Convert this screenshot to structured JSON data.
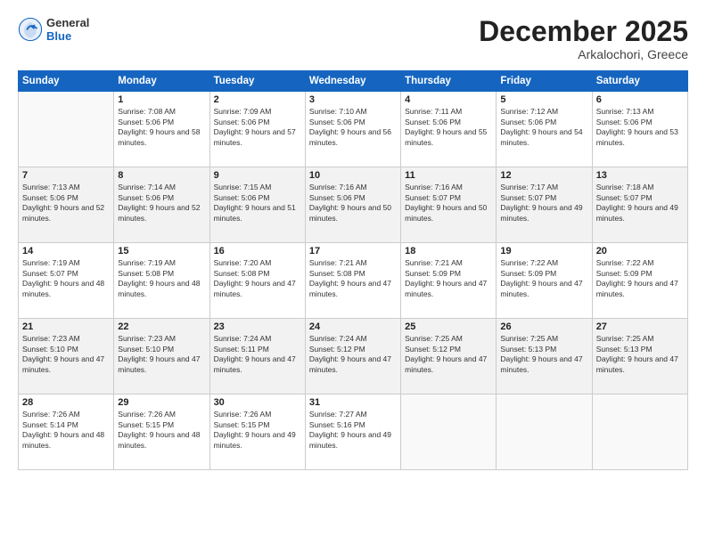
{
  "header": {
    "logo_general": "General",
    "logo_blue": "Blue",
    "month_title": "December 2025",
    "location": "Arkalochori, Greece"
  },
  "days_of_week": [
    "Sunday",
    "Monday",
    "Tuesday",
    "Wednesday",
    "Thursday",
    "Friday",
    "Saturday"
  ],
  "weeks": [
    [
      {
        "day": "",
        "sunrise": "",
        "sunset": "",
        "daylight": ""
      },
      {
        "day": "1",
        "sunrise": "Sunrise: 7:08 AM",
        "sunset": "Sunset: 5:06 PM",
        "daylight": "Daylight: 9 hours and 58 minutes."
      },
      {
        "day": "2",
        "sunrise": "Sunrise: 7:09 AM",
        "sunset": "Sunset: 5:06 PM",
        "daylight": "Daylight: 9 hours and 57 minutes."
      },
      {
        "day": "3",
        "sunrise": "Sunrise: 7:10 AM",
        "sunset": "Sunset: 5:06 PM",
        "daylight": "Daylight: 9 hours and 56 minutes."
      },
      {
        "day": "4",
        "sunrise": "Sunrise: 7:11 AM",
        "sunset": "Sunset: 5:06 PM",
        "daylight": "Daylight: 9 hours and 55 minutes."
      },
      {
        "day": "5",
        "sunrise": "Sunrise: 7:12 AM",
        "sunset": "Sunset: 5:06 PM",
        "daylight": "Daylight: 9 hours and 54 minutes."
      },
      {
        "day": "6",
        "sunrise": "Sunrise: 7:13 AM",
        "sunset": "Sunset: 5:06 PM",
        "daylight": "Daylight: 9 hours and 53 minutes."
      }
    ],
    [
      {
        "day": "7",
        "sunrise": "Sunrise: 7:13 AM",
        "sunset": "Sunset: 5:06 PM",
        "daylight": "Daylight: 9 hours and 52 minutes."
      },
      {
        "day": "8",
        "sunrise": "Sunrise: 7:14 AM",
        "sunset": "Sunset: 5:06 PM",
        "daylight": "Daylight: 9 hours and 52 minutes."
      },
      {
        "day": "9",
        "sunrise": "Sunrise: 7:15 AM",
        "sunset": "Sunset: 5:06 PM",
        "daylight": "Daylight: 9 hours and 51 minutes."
      },
      {
        "day": "10",
        "sunrise": "Sunrise: 7:16 AM",
        "sunset": "Sunset: 5:06 PM",
        "daylight": "Daylight: 9 hours and 50 minutes."
      },
      {
        "day": "11",
        "sunrise": "Sunrise: 7:16 AM",
        "sunset": "Sunset: 5:07 PM",
        "daylight": "Daylight: 9 hours and 50 minutes."
      },
      {
        "day": "12",
        "sunrise": "Sunrise: 7:17 AM",
        "sunset": "Sunset: 5:07 PM",
        "daylight": "Daylight: 9 hours and 49 minutes."
      },
      {
        "day": "13",
        "sunrise": "Sunrise: 7:18 AM",
        "sunset": "Sunset: 5:07 PM",
        "daylight": "Daylight: 9 hours and 49 minutes."
      }
    ],
    [
      {
        "day": "14",
        "sunrise": "Sunrise: 7:19 AM",
        "sunset": "Sunset: 5:07 PM",
        "daylight": "Daylight: 9 hours and 48 minutes."
      },
      {
        "day": "15",
        "sunrise": "Sunrise: 7:19 AM",
        "sunset": "Sunset: 5:08 PM",
        "daylight": "Daylight: 9 hours and 48 minutes."
      },
      {
        "day": "16",
        "sunrise": "Sunrise: 7:20 AM",
        "sunset": "Sunset: 5:08 PM",
        "daylight": "Daylight: 9 hours and 47 minutes."
      },
      {
        "day": "17",
        "sunrise": "Sunrise: 7:21 AM",
        "sunset": "Sunset: 5:08 PM",
        "daylight": "Daylight: 9 hours and 47 minutes."
      },
      {
        "day": "18",
        "sunrise": "Sunrise: 7:21 AM",
        "sunset": "Sunset: 5:09 PM",
        "daylight": "Daylight: 9 hours and 47 minutes."
      },
      {
        "day": "19",
        "sunrise": "Sunrise: 7:22 AM",
        "sunset": "Sunset: 5:09 PM",
        "daylight": "Daylight: 9 hours and 47 minutes."
      },
      {
        "day": "20",
        "sunrise": "Sunrise: 7:22 AM",
        "sunset": "Sunset: 5:09 PM",
        "daylight": "Daylight: 9 hours and 47 minutes."
      }
    ],
    [
      {
        "day": "21",
        "sunrise": "Sunrise: 7:23 AM",
        "sunset": "Sunset: 5:10 PM",
        "daylight": "Daylight: 9 hours and 47 minutes."
      },
      {
        "day": "22",
        "sunrise": "Sunrise: 7:23 AM",
        "sunset": "Sunset: 5:10 PM",
        "daylight": "Daylight: 9 hours and 47 minutes."
      },
      {
        "day": "23",
        "sunrise": "Sunrise: 7:24 AM",
        "sunset": "Sunset: 5:11 PM",
        "daylight": "Daylight: 9 hours and 47 minutes."
      },
      {
        "day": "24",
        "sunrise": "Sunrise: 7:24 AM",
        "sunset": "Sunset: 5:12 PM",
        "daylight": "Daylight: 9 hours and 47 minutes."
      },
      {
        "day": "25",
        "sunrise": "Sunrise: 7:25 AM",
        "sunset": "Sunset: 5:12 PM",
        "daylight": "Daylight: 9 hours and 47 minutes."
      },
      {
        "day": "26",
        "sunrise": "Sunrise: 7:25 AM",
        "sunset": "Sunset: 5:13 PM",
        "daylight": "Daylight: 9 hours and 47 minutes."
      },
      {
        "day": "27",
        "sunrise": "Sunrise: 7:25 AM",
        "sunset": "Sunset: 5:13 PM",
        "daylight": "Daylight: 9 hours and 47 minutes."
      }
    ],
    [
      {
        "day": "28",
        "sunrise": "Sunrise: 7:26 AM",
        "sunset": "Sunset: 5:14 PM",
        "daylight": "Daylight: 9 hours and 48 minutes."
      },
      {
        "day": "29",
        "sunrise": "Sunrise: 7:26 AM",
        "sunset": "Sunset: 5:15 PM",
        "daylight": "Daylight: 9 hours and 48 minutes."
      },
      {
        "day": "30",
        "sunrise": "Sunrise: 7:26 AM",
        "sunset": "Sunset: 5:15 PM",
        "daylight": "Daylight: 9 hours and 49 minutes."
      },
      {
        "day": "31",
        "sunrise": "Sunrise: 7:27 AM",
        "sunset": "Sunset: 5:16 PM",
        "daylight": "Daylight: 9 hours and 49 minutes."
      },
      {
        "day": "",
        "sunrise": "",
        "sunset": "",
        "daylight": ""
      },
      {
        "day": "",
        "sunrise": "",
        "sunset": "",
        "daylight": ""
      },
      {
        "day": "",
        "sunrise": "",
        "sunset": "",
        "daylight": ""
      }
    ]
  ]
}
